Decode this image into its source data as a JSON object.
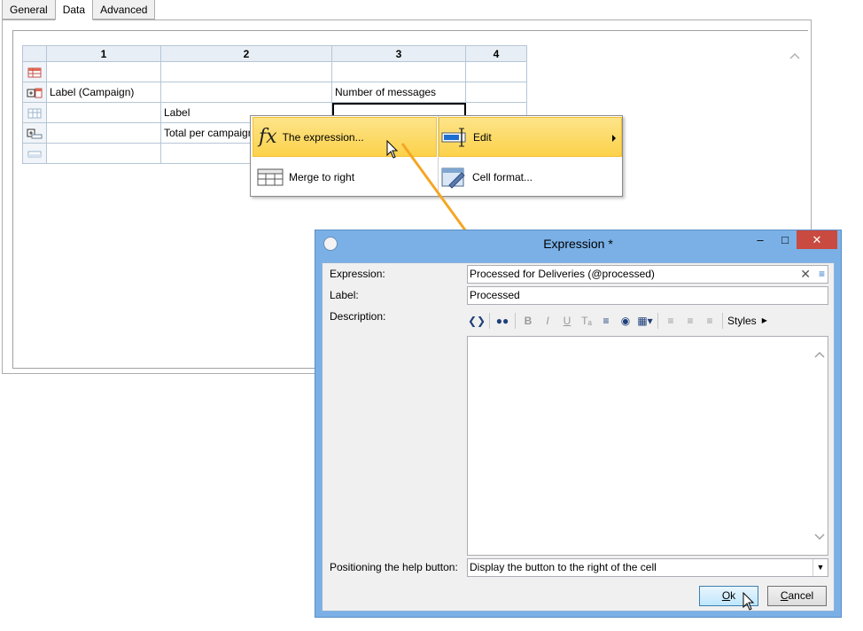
{
  "tabs": {
    "general": "General",
    "data": "Data",
    "advanced": "Advanced"
  },
  "grid": {
    "columns": [
      "1",
      "2",
      "3",
      "4"
    ],
    "rows": [
      [
        "",
        "",
        "",
        ""
      ],
      [
        "Label (Campaign)",
        "",
        "Number of messages",
        ""
      ],
      [
        "",
        "Label",
        "",
        ""
      ],
      [
        "",
        "Total per campaign",
        "",
        ""
      ],
      [
        "",
        "",
        "",
        ""
      ]
    ]
  },
  "context_menu": {
    "expression": "The expression...",
    "edit": "Edit",
    "merge_right": "Merge to right",
    "cell_format": "Cell format..."
  },
  "dialog": {
    "title": "Expression *",
    "expression_label": "Expression:",
    "expression_value": "Processed for Deliveries (@processed)",
    "label_label": "Label:",
    "label_value": "Processed",
    "description_label": "Description:",
    "styles_label": "Styles",
    "positioning_label": "Positioning the help button:",
    "positioning_value": "Display the button to the right of the cell",
    "ok": "Ok",
    "cancel": "Cancel",
    "toolbar_bold": "B",
    "toolbar_italic": "I",
    "toolbar_underline": "U"
  },
  "colors": {
    "highlight": "#fcd24a",
    "dialog_frame": "#7ab0e6",
    "arrow": "#f5a623",
    "close": "#c94a40"
  }
}
